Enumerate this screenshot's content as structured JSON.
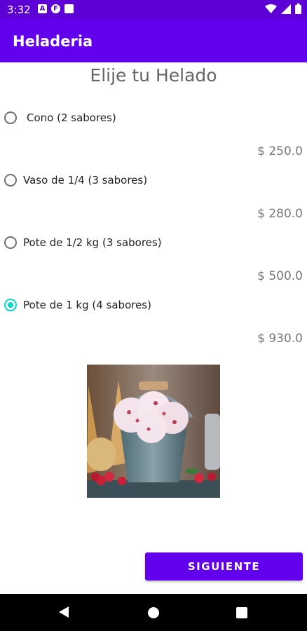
{
  "status_bar": {
    "time": "3:32",
    "icons": [
      "a-icon",
      "f-icon",
      "sd-card-icon",
      "wifi-icon",
      "signal-icon",
      "battery-icon"
    ]
  },
  "app_bar": {
    "title": "Heladeria"
  },
  "screen": {
    "title": "Elije tu Helado",
    "options": [
      {
        "label": "Cono (2 sabores)",
        "price": "$ 250.0",
        "selected": false
      },
      {
        "label": "Vaso de 1/4 (3 sabores)",
        "price": "$ 280.0",
        "selected": false
      },
      {
        "label": "Pote de 1/2 kg (3 sabores)",
        "price": "$ 500.0",
        "selected": false
      },
      {
        "label": "Pote de 1 kg (4 sabores)",
        "price": "$ 930.0",
        "selected": true
      }
    ],
    "image": "ice-cream-bucket",
    "next_button": "SIGUIENTE"
  },
  "colors": {
    "primary": "#6200ee",
    "status": "#5c00d6",
    "accent": "#03dac5"
  }
}
